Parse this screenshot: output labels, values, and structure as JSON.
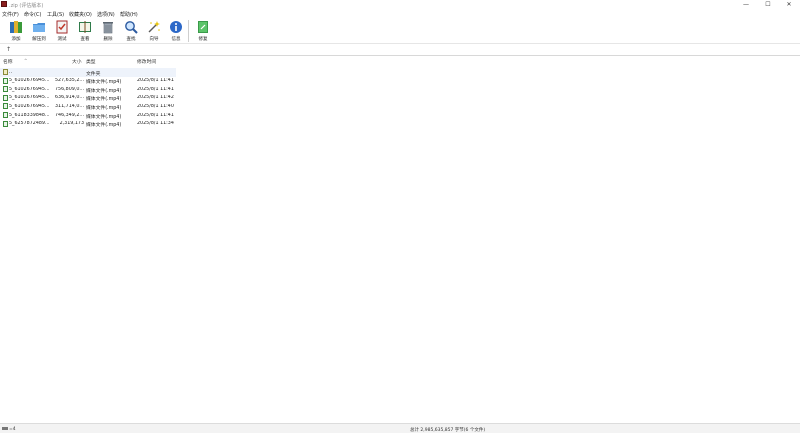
{
  "window": {
    "title": ".zip (评估版本)",
    "minimize": "—",
    "maximize": "☐",
    "close": "✕"
  },
  "menu": {
    "items": [
      {
        "label": "文件(F)"
      },
      {
        "label": "命令(C)"
      },
      {
        "label": "工具(S)"
      },
      {
        "label": "收藏夹(O)"
      },
      {
        "label": "选项(N)"
      },
      {
        "label": "帮助(H)"
      }
    ]
  },
  "toolbar": {
    "buttons": [
      {
        "label": "添加",
        "icon": "add-archive-icon"
      },
      {
        "label": "解压到",
        "icon": "extract-to-icon"
      },
      {
        "label": "测试",
        "icon": "test-icon"
      },
      {
        "label": "查看",
        "icon": "view-icon"
      },
      {
        "label": "删除",
        "icon": "delete-icon"
      },
      {
        "label": "查找",
        "icon": "find-icon"
      },
      {
        "label": "向导",
        "icon": "wizard-icon"
      },
      {
        "label": "信息",
        "icon": "info-icon"
      },
      {
        "label": "修复",
        "icon": "repair-icon"
      }
    ]
  },
  "address": {
    "up": "↑"
  },
  "list": {
    "columns": {
      "name": "名称",
      "size": "大小",
      "type": "类型",
      "modified": "修改时间"
    },
    "rows": [
      {
        "name": "..",
        "size": "",
        "type": "文件夹",
        "modified": "",
        "kind": "folder"
      },
      {
        "name": "5_6102676945...",
        "size": "527,635,2...",
        "type": "媒体文件(.mp4)",
        "modified": "2025/8/1 11:41",
        "kind": "file"
      },
      {
        "name": "5_6102676945...",
        "size": "756,809,0...",
        "type": "媒体文件(.mp4)",
        "modified": "2025/8/1 11:41",
        "kind": "file"
      },
      {
        "name": "5_6102676945...",
        "size": "636,914,0...",
        "type": "媒体文件(.mp4)",
        "modified": "2025/8/1 11:42",
        "kind": "file"
      },
      {
        "name": "5_6102676945...",
        "size": "311,714,0...",
        "type": "媒体文件(.mp4)",
        "modified": "2025/8/1 11:40",
        "kind": "file"
      },
      {
        "name": "5_6118339848...",
        "size": "746,349,2...",
        "type": "媒体文件(.mp4)",
        "modified": "2025/8/1 11:41",
        "kind": "file"
      },
      {
        "name": "5_6257872489...",
        "size": "2,319,173",
        "type": "媒体文件(.mp4)",
        "modified": "2025/8/1 11:34",
        "kind": "file"
      }
    ]
  },
  "status": {
    "left": "=4",
    "right": "总计 2,985,635,857 字节(6 个文件)"
  },
  "colors": {
    "selection": "#eef3fb",
    "file_icon": "#3a8a3a",
    "folder_icon": "#f0ecc0"
  }
}
